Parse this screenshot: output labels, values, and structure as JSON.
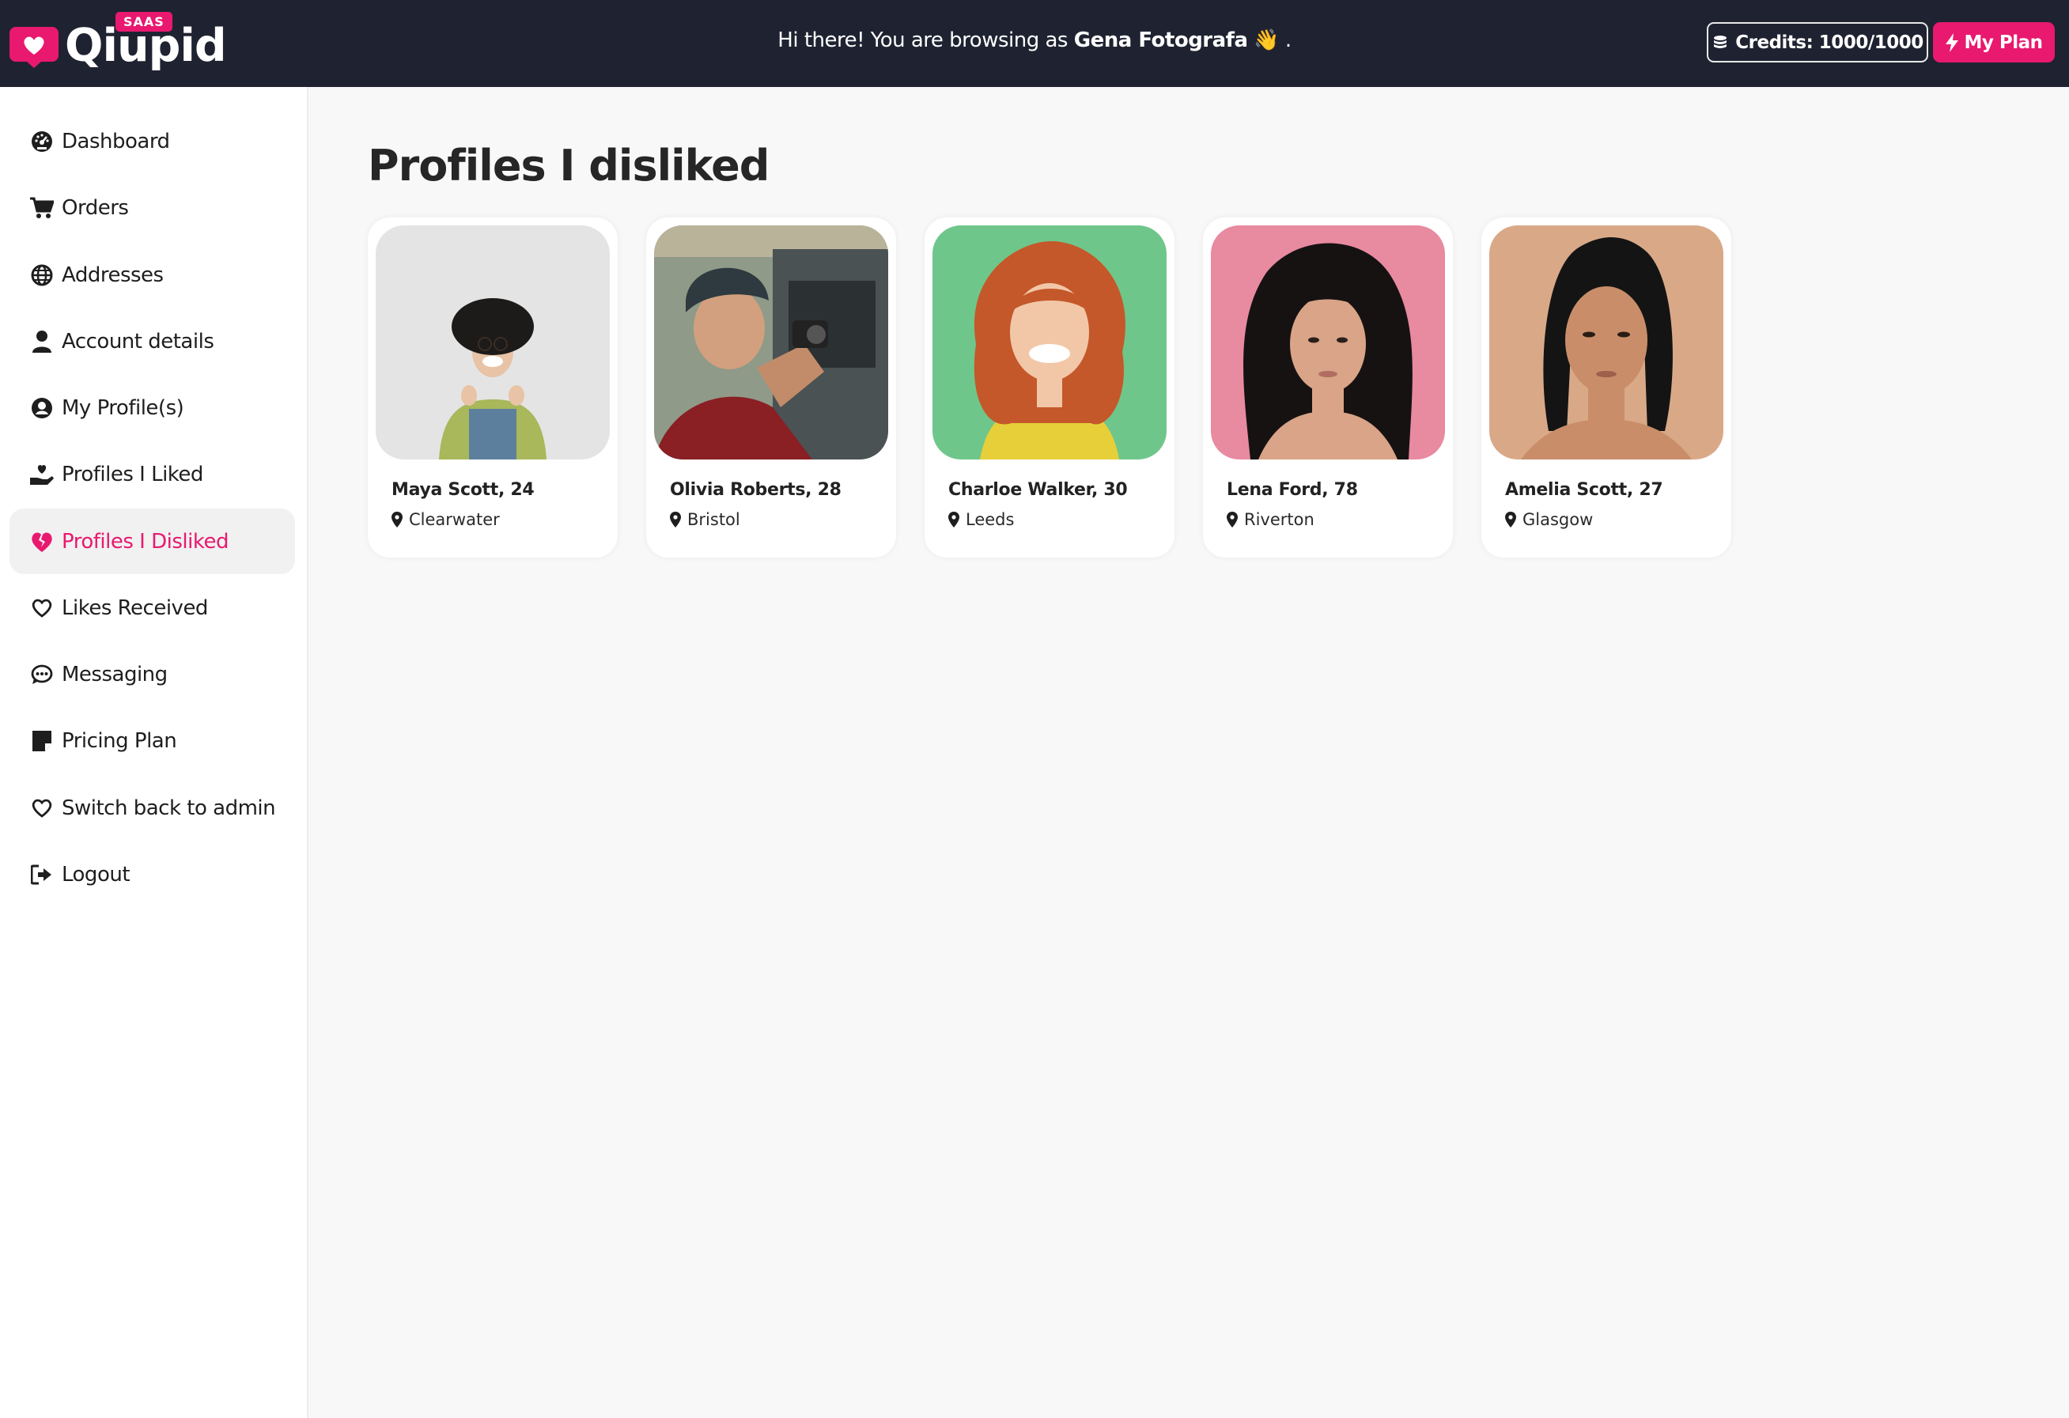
{
  "header": {
    "brand": "Qiupid",
    "badge": "SAAS",
    "greeting_prefix": "Hi there! You are browsing as",
    "user_name": "Gena Fotografa",
    "greeting_suffix": "👋 .",
    "credits_label": "Credits: 1000/1000",
    "plan_label": "My Plan",
    "accent_color": "#e8196f"
  },
  "sidebar": {
    "items": [
      {
        "label": "Dashboard",
        "icon": "gauge-icon"
      },
      {
        "label": "Orders",
        "icon": "cart-icon"
      },
      {
        "label": "Addresses",
        "icon": "globe-icon"
      },
      {
        "label": "Account details",
        "icon": "user-icon"
      },
      {
        "label": "My Profile(s)",
        "icon": "user-circle-icon"
      },
      {
        "label": "Profiles I Liked",
        "icon": "hand-holding-heart-icon"
      },
      {
        "label": "Profiles I Disliked",
        "icon": "heart-crack-icon",
        "active": true
      },
      {
        "label": "Likes Received",
        "icon": "heart-outline-icon"
      },
      {
        "label": "Messaging",
        "icon": "comment-dots-icon"
      },
      {
        "label": "Pricing Plan",
        "icon": "note-icon"
      },
      {
        "label": "Switch back to admin",
        "icon": "heart-outline-icon"
      },
      {
        "label": "Logout",
        "icon": "sign-out-icon"
      }
    ]
  },
  "main": {
    "title": "Profiles I disliked",
    "profiles": [
      {
        "name": "Maya Scott",
        "age": ", 24",
        "location": "Clearwater",
        "bg": "#e4e4e4"
      },
      {
        "name": "Olivia Roberts",
        "age": ", 28",
        "location": "Bristol",
        "bg": "#5b6b6a"
      },
      {
        "name": "Charloe Walker",
        "age": ", 30",
        "location": "Leeds",
        "bg": "#6fc68a"
      },
      {
        "name": "Lena Ford",
        "age": ", 78",
        "location": "Riverton",
        "bg": "#e88aa0"
      },
      {
        "name": "Amelia Scott",
        "age": ", 27",
        "location": "Glasgow",
        "bg": "#d9a987"
      }
    ]
  }
}
